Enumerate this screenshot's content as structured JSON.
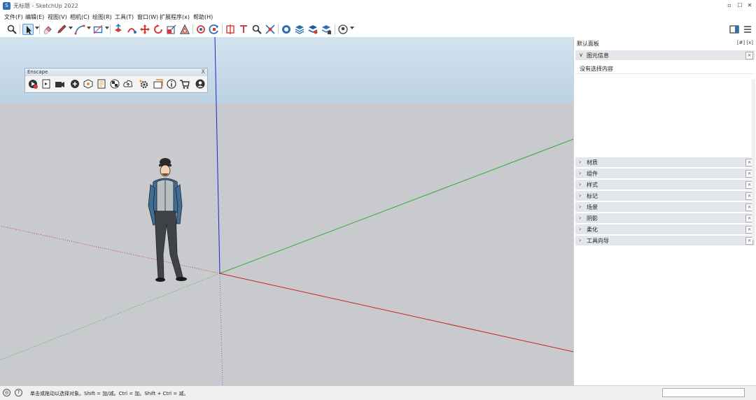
{
  "window": {
    "title": "无标题 - SketchUp 2022",
    "app_icon": "sketchup-icon"
  },
  "menu": [
    {
      "label": "文件(F)"
    },
    {
      "label": "编辑(E)"
    },
    {
      "label": "视图(V)"
    },
    {
      "label": "相机(C)"
    },
    {
      "label": "绘图(R)"
    },
    {
      "label": "工具(T)"
    },
    {
      "label": "窗口(W)"
    },
    {
      "label": "扩展程序(x)"
    },
    {
      "label": "帮助(H)"
    }
  ],
  "toolbar": {
    "icons": [
      "search-icon",
      "select-arrow-icon",
      "eraser-icon",
      "pencil-icon",
      "line-icon",
      "rectangle-icon",
      "push-pull-icon",
      "follow-me-icon",
      "move-icon",
      "rotate-icon",
      "scale-icon",
      "offset-icon",
      "orbit-icon",
      "pan-icon",
      "tape-measure-icon",
      "text-icon",
      "zoom-icon",
      "zoom-extents-icon",
      "warehouse-icon",
      "layers-icon",
      "components-icon",
      "extension-icon"
    ],
    "active_tool": "select-arrow-icon",
    "right_icons": [
      "dock-icon",
      "panel-toggle-icon"
    ]
  },
  "enscape": {
    "title": "Enscape",
    "close": "X",
    "icons": [
      "start-enscape-icon",
      "sync-icon",
      "video-icon",
      "capture-icon",
      "settings-icon",
      "view-icon",
      "texture-icon",
      "checker-icon",
      "upload-icon",
      "gear-icon",
      "export-icon",
      "info-icon",
      "cart-icon",
      "account-icon"
    ]
  },
  "tray": {
    "title": "默认面板",
    "pin": "[#] [x]",
    "entity_info_label": "图元信息",
    "no_selection": "没有选择内容",
    "items": [
      {
        "label": "材质"
      },
      {
        "label": "组件"
      },
      {
        "label": "样式"
      },
      {
        "label": "标记"
      },
      {
        "label": "场景"
      },
      {
        "label": "阴影"
      },
      {
        "label": "柔化"
      },
      {
        "label": "工具向导"
      }
    ]
  },
  "status": {
    "instruction": "单击或拖动以选择对象。Shift = 加/减。Ctrl = 加。Shift + Ctrl = 减。",
    "measurement_label": "",
    "measurement_value": ""
  },
  "colors": {
    "sky": "#c8dbe8",
    "ground": "#c8cace",
    "axis_red": "#cc2222",
    "axis_green": "#33aa33",
    "axis_blue": "#2222cc",
    "accent": "#2d6fb5"
  }
}
